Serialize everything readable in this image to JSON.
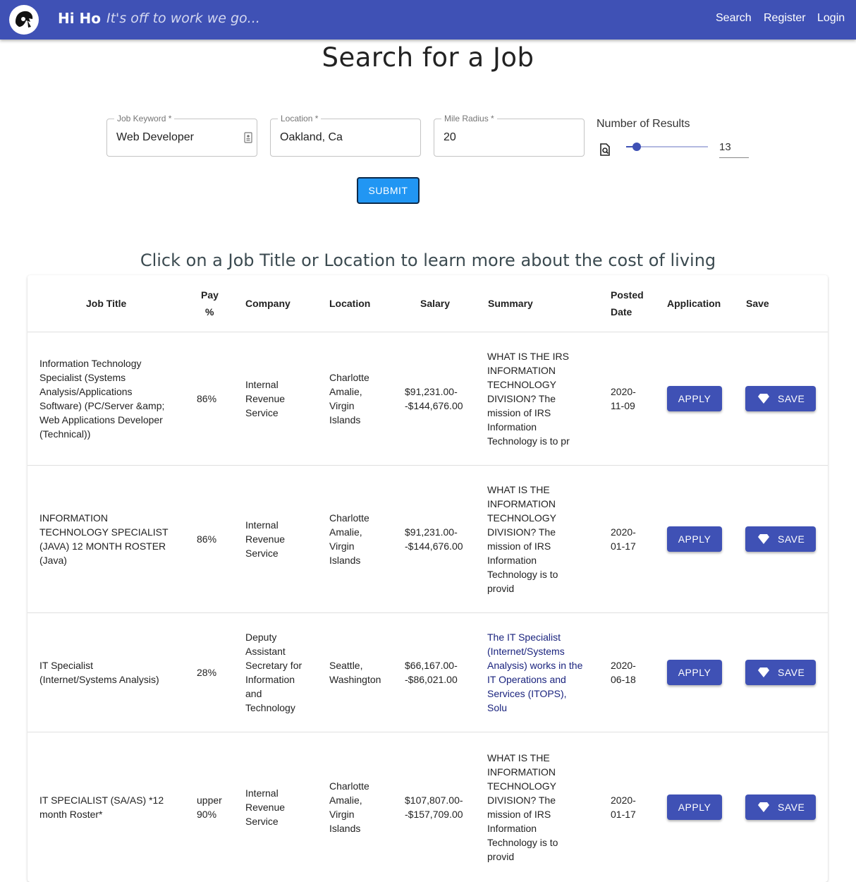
{
  "header": {
    "brand": "Hi Ho",
    "tagline": "It's off to work we go...",
    "nav": [
      "Search",
      "Register",
      "Login"
    ]
  },
  "page_title": "Search for a Job",
  "form": {
    "keyword": {
      "label": "Job Keyword *",
      "value": "Web Developer"
    },
    "location": {
      "label": "Location *",
      "value": "Oakland, Ca"
    },
    "radius": {
      "label": "Mile Radius *",
      "value": "20"
    },
    "results": {
      "label": "Number of Results",
      "value": "13",
      "level": 0.13
    },
    "submit_label": "SUBMIT"
  },
  "subtitle": "Click on a Job Title or Location to learn more about the cost of living",
  "table": {
    "headers": {
      "title": "Job Title",
      "pay_1": "Pay",
      "pay_2": "%",
      "company": "Company",
      "location": "Location",
      "salary": "Salary",
      "summary": "Summary",
      "posted_1": "Posted",
      "posted_2": "Date",
      "application": "Application",
      "save": "Save"
    },
    "apply_label": "APPLY",
    "save_label": "SAVE",
    "rows": [
      {
        "title": [
          "Information Technology",
          "Specialist (Systems",
          "Analysis/Applications",
          "Software) (PC/Server &amp;",
          "Web Applications Developer",
          "(Technical))"
        ],
        "pay": [
          "86%"
        ],
        "company": [
          "Internal",
          "Revenue",
          "Service"
        ],
        "location": [
          "Charlotte",
          "Amalie,",
          "Virgin",
          "Islands"
        ],
        "salary": [
          "$91,231.00-",
          "-$144,676.00"
        ],
        "summary": [
          "WHAT IS THE IRS",
          "INFORMATION",
          "TECHNOLOGY",
          "DIVISION? The",
          "mission of IRS",
          "Information",
          "Technology is to pr"
        ],
        "date": [
          "2020-",
          "11-09"
        ]
      },
      {
        "title": [
          "INFORMATION",
          "TECHNOLOGY SPECIALIST",
          "(JAVA) 12 MONTH ROSTER",
          "(Java)"
        ],
        "pay": [
          "86%"
        ],
        "company": [
          "Internal",
          "Revenue",
          "Service"
        ],
        "location": [
          "Charlotte",
          "Amalie,",
          "Virgin",
          "Islands"
        ],
        "salary": [
          "$91,231.00-",
          "-$144,676.00"
        ],
        "summary": [
          "WHAT IS THE",
          "INFORMATION",
          "TECHNOLOGY",
          "DIVISION? The",
          "mission of IRS",
          "Information",
          "Technology is to",
          "provid"
        ],
        "date": [
          "2020-",
          "01-17"
        ]
      },
      {
        "title": [
          "IT Specialist",
          "(Internet/Systems Analysis)"
        ],
        "pay": [
          "28%"
        ],
        "company": [
          "Deputy",
          "Assistant",
          "Secretary for",
          "Information",
          "and",
          "Technology"
        ],
        "location": [
          "Seattle,",
          "Washington"
        ],
        "salary": [
          "$66,167.00-",
          "-$86,021.00"
        ],
        "summary": [
          "The IT Specialist",
          "(Internet/Systems",
          "Analysis) works in the",
          "IT Operations and",
          "Services (ITOPS),",
          "Solu"
        ],
        "date": [
          "2020-",
          "06-18"
        ]
      },
      {
        "title": [
          "IT SPECIALIST (SA/AS) *12",
          "month Roster*"
        ],
        "pay": [
          "upper",
          "90%"
        ],
        "company": [
          "Internal",
          "Revenue",
          "Service"
        ],
        "location": [
          "Charlotte",
          "Amalie,",
          "Virgin",
          "Islands"
        ],
        "salary": [
          "$107,807.00-",
          "-$157,709.00"
        ],
        "summary": [
          "WHAT IS THE",
          "INFORMATION",
          "TECHNOLOGY",
          "DIVISION? The",
          "mission of IRS",
          "Information",
          "Technology is to",
          "provid"
        ],
        "date": [
          "2020-",
          "01-17"
        ]
      }
    ]
  }
}
